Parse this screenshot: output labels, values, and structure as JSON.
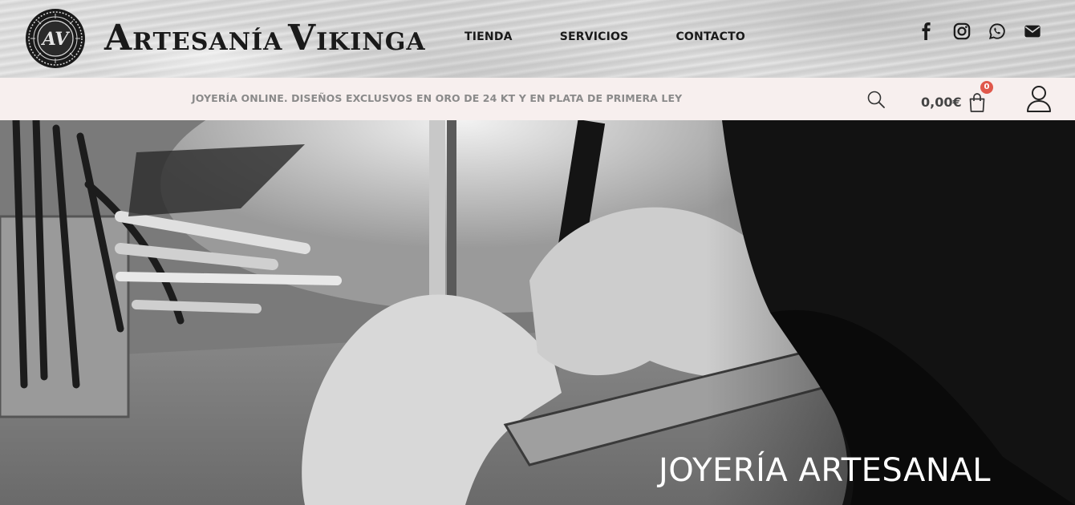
{
  "header": {
    "brand": {
      "first_cap": "A",
      "first_rest": "RTESANÍA",
      "second_cap": "V",
      "second_rest": "IKINGA"
    },
    "seal_monogram": "AV",
    "nav": [
      {
        "label": "TIENDA"
      },
      {
        "label": "SERVICIOS"
      },
      {
        "label": "CONTACTO"
      }
    ],
    "social": [
      {
        "icon": "facebook-icon"
      },
      {
        "icon": "instagram-icon"
      },
      {
        "icon": "whatsapp-icon"
      },
      {
        "icon": "email-icon"
      }
    ]
  },
  "promo": {
    "text": "JOYERÍA ONLINE. DISEÑOS EXCLUSVOS EN ORO DE 24 KT Y EN PLATA DE PRIMERA LEY"
  },
  "cart": {
    "total": "0,00€",
    "count": "0"
  },
  "hero": {
    "title": "JOYERÍA ARTESANAL",
    "image": "black-and-white photo of a craftsman engraving jewelry at a workbench with pliers in a tin"
  },
  "colors": {
    "promo_bg": "#f7efee",
    "promo_text": "#8a8a8a",
    "badge": "#e0584b",
    "nav_text": "#1a1a1a"
  }
}
